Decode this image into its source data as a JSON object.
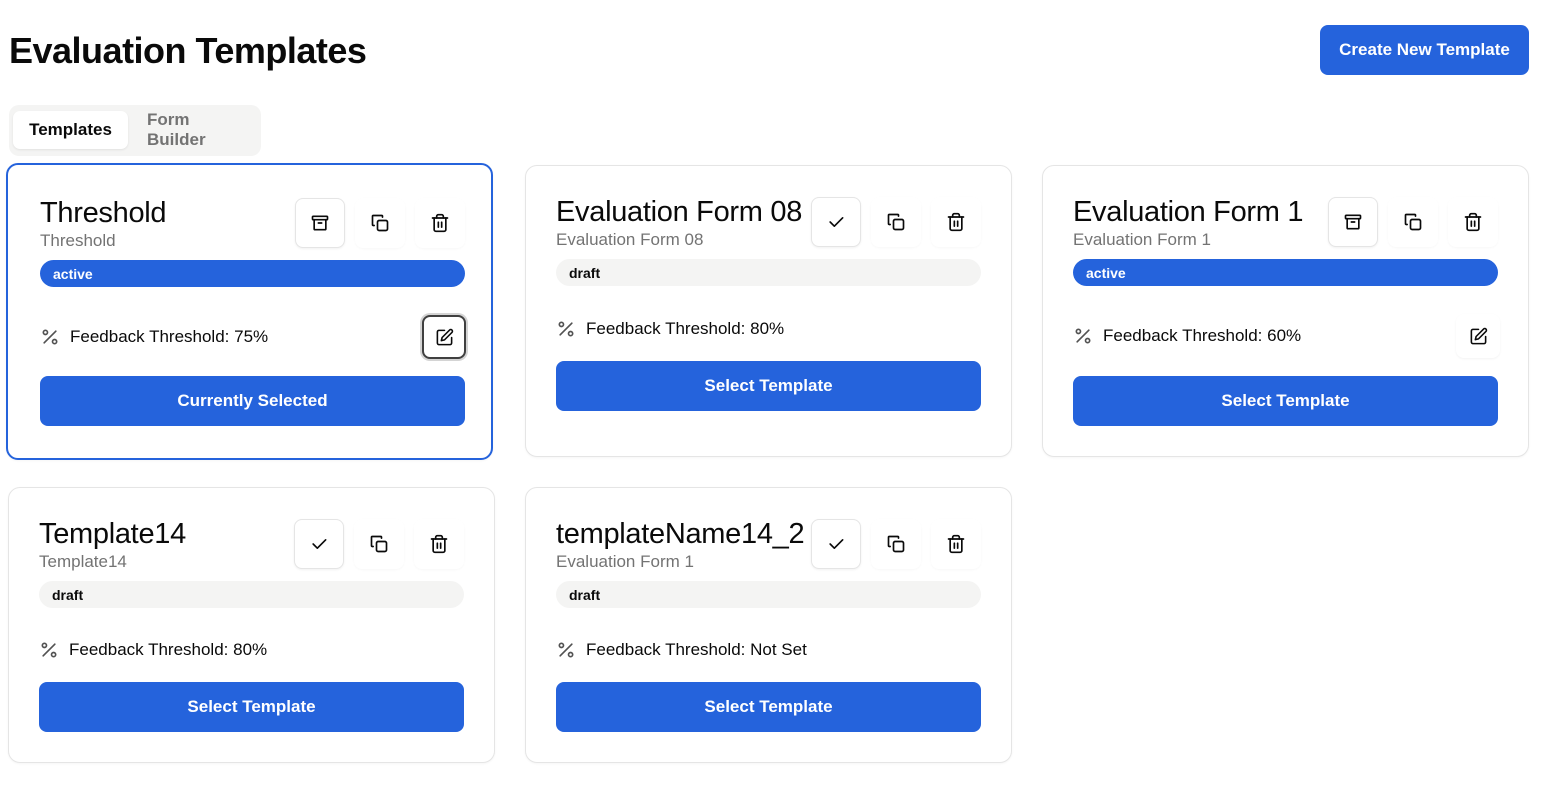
{
  "header": {
    "title": "Evaluation Templates",
    "create_button_label": "Create New Template"
  },
  "tabs": [
    {
      "label": "Templates",
      "active": true
    },
    {
      "label": "Form Builder",
      "active": false
    }
  ],
  "colors": {
    "accent": "#2563dc",
    "muted_text": "#737373",
    "badge_draft_bg": "#f4f4f3"
  },
  "cards": [
    {
      "title": "Threshold",
      "subtitle": "Threshold",
      "status": "active",
      "threshold_text": "Feedback Threshold: 75%",
      "action_label": "Currently Selected",
      "selected": true,
      "status_action_icon": "archive-icon",
      "has_edit": true
    },
    {
      "title": "Evaluation Form 08",
      "subtitle": "Evaluation Form 08",
      "status": "draft",
      "threshold_text": "Feedback Threshold: 80%",
      "action_label": "Select Template",
      "selected": false,
      "status_action_icon": "check-icon",
      "has_edit": false
    },
    {
      "title": "Evaluation Form 1",
      "subtitle": "Evaluation Form 1",
      "status": "active",
      "threshold_text": "Feedback Threshold: 60%",
      "action_label": "Select Template",
      "selected": false,
      "status_action_icon": "archive-icon",
      "has_edit": true
    },
    {
      "title": "Template14",
      "subtitle": "Template14",
      "status": "draft",
      "threshold_text": "Feedback Threshold: 80%",
      "action_label": "Select Template",
      "selected": false,
      "status_action_icon": "check-icon",
      "has_edit": false
    },
    {
      "title": "templateName14_2",
      "subtitle": "Evaluation Form 1",
      "status": "draft",
      "threshold_text": "Feedback Threshold: Not Set",
      "action_label": "Select Template",
      "selected": false,
      "status_action_icon": "check-icon",
      "has_edit": false
    }
  ]
}
